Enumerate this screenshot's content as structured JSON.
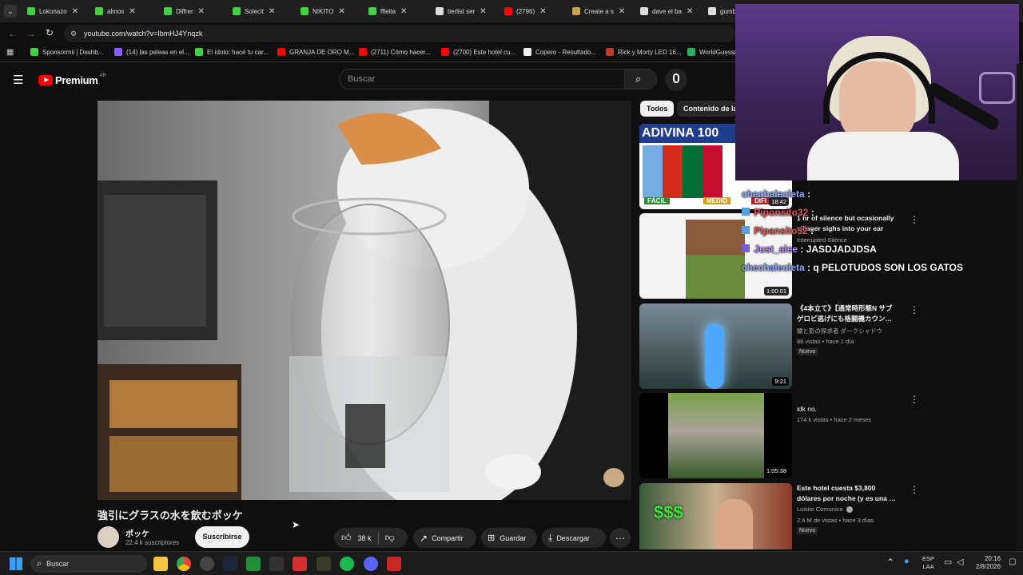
{
  "browser": {
    "tabs": [
      {
        "label": "Lokonazo",
        "color": "#3fd13f"
      },
      {
        "label": "almos",
        "color": "#3fd13f"
      },
      {
        "label": "Diffrer",
        "color": "#3fd13f"
      },
      {
        "label": "Solecit",
        "color": "#3fd13f"
      },
      {
        "label": "NIKITO",
        "color": "#3fd13f"
      },
      {
        "label": "ffleita",
        "color": "#3fd13f"
      },
      {
        "label": "tierlist ser",
        "color": "#dddddd"
      },
      {
        "label": "(2796)",
        "color": "#ff0000"
      },
      {
        "label": "Create a s",
        "color": "#c8a24a"
      },
      {
        "label": "dave el ba",
        "color": "#dddddd"
      },
      {
        "label": "gumb",
        "color": "#dddddd"
      }
    ],
    "url": "youtube.com/watch?v=IbmHJ4Ynqzk",
    "bookmarks": [
      {
        "label": "Sponsormii | Dashb...",
        "color": "#3fd13f"
      },
      {
        "label": "(14) las peleas en el...",
        "color": "#8b5cf6"
      },
      {
        "label": "El ídolo: hacé tu car...",
        "color": "#3fd13f"
      },
      {
        "label": "GRANJA DE ORO M...",
        "color": "#ff0000"
      },
      {
        "label": "(2711) Cómo hacer...",
        "color": "#ff0000"
      },
      {
        "label": "(2700) Este hotel cu...",
        "color": "#ff0000"
      },
      {
        "label": "Copero - Resultado...",
        "color": "#eeeeee"
      },
      {
        "label": "Rick y Morty LED 16...",
        "color": "#c0392b"
      },
      {
        "label": "WorldGuessr",
        "color": "#27ae60"
      }
    ]
  },
  "youtube": {
    "logo_text": "Premium",
    "region": "AR",
    "search_placeholder": "Buscar",
    "video_title": "強引にグラスの水を飲むポッケ",
    "channel_name": "ポッケ",
    "subscribers": "22.4 k suscriptores",
    "subscribe_label": "Suscribirse",
    "likes": "38 k",
    "share_label": "Compartir",
    "save_label": "Guardar",
    "download_label": "Descargar",
    "chips": [
      "Todos",
      "Contenido de la"
    ],
    "related": [
      {
        "title": "ADIVINA 100",
        "thumb_label": "FÁCIL",
        "thumb_label2": "MEDIO",
        "thumb_label3": "DIFI",
        "duration": "18:42"
      },
      {
        "title": "1 hr of silence but ocasionally villager sighs into your ear",
        "channel": "Interrupted Silence",
        "duration": "1:00:01"
      },
      {
        "title": "《4本立て》【通常時形態N サブ ゲロビ逃げにも格闘機カウン…",
        "channel": "闇と影の探求者 ダークシャドウ",
        "meta": "88 vistas • hace 1 día",
        "badge": "Nuevo",
        "duration": "9:21"
      },
      {
        "title": "idk no.",
        "meta": "174 k vistas • hace 2 meses",
        "duration": "1:05:38"
      },
      {
        "title": "Este hotel cuesta $3,800 dólares por noche (y es una …",
        "channel": "Luisito Comunica",
        "meta": "2.8 M de vistas • hace 3 días",
        "badge": "Nuevo",
        "duration": ""
      }
    ]
  },
  "chat": [
    {
      "user": "chechalecleta",
      "text": ":"
    },
    {
      "user": "Piponsito32",
      "text": ":"
    },
    {
      "user": "Pipansito32",
      "text": ":"
    },
    {
      "user": "Just_alee",
      "text": ": JASDJADJDSA"
    },
    {
      "user": "chechalecleta",
      "text": ": q PELOTUDOS SON LOS GATOS"
    }
  ],
  "taskbar": {
    "search_label": "Buscar",
    "lang_top": "ESP",
    "lang_bottom": "LAA",
    "time": "20:16",
    "date": "2/8/2026"
  },
  "colors": {
    "accent": "#ff0000",
    "background": "#0f0f0f",
    "chat_user": "#8fa8ff"
  }
}
